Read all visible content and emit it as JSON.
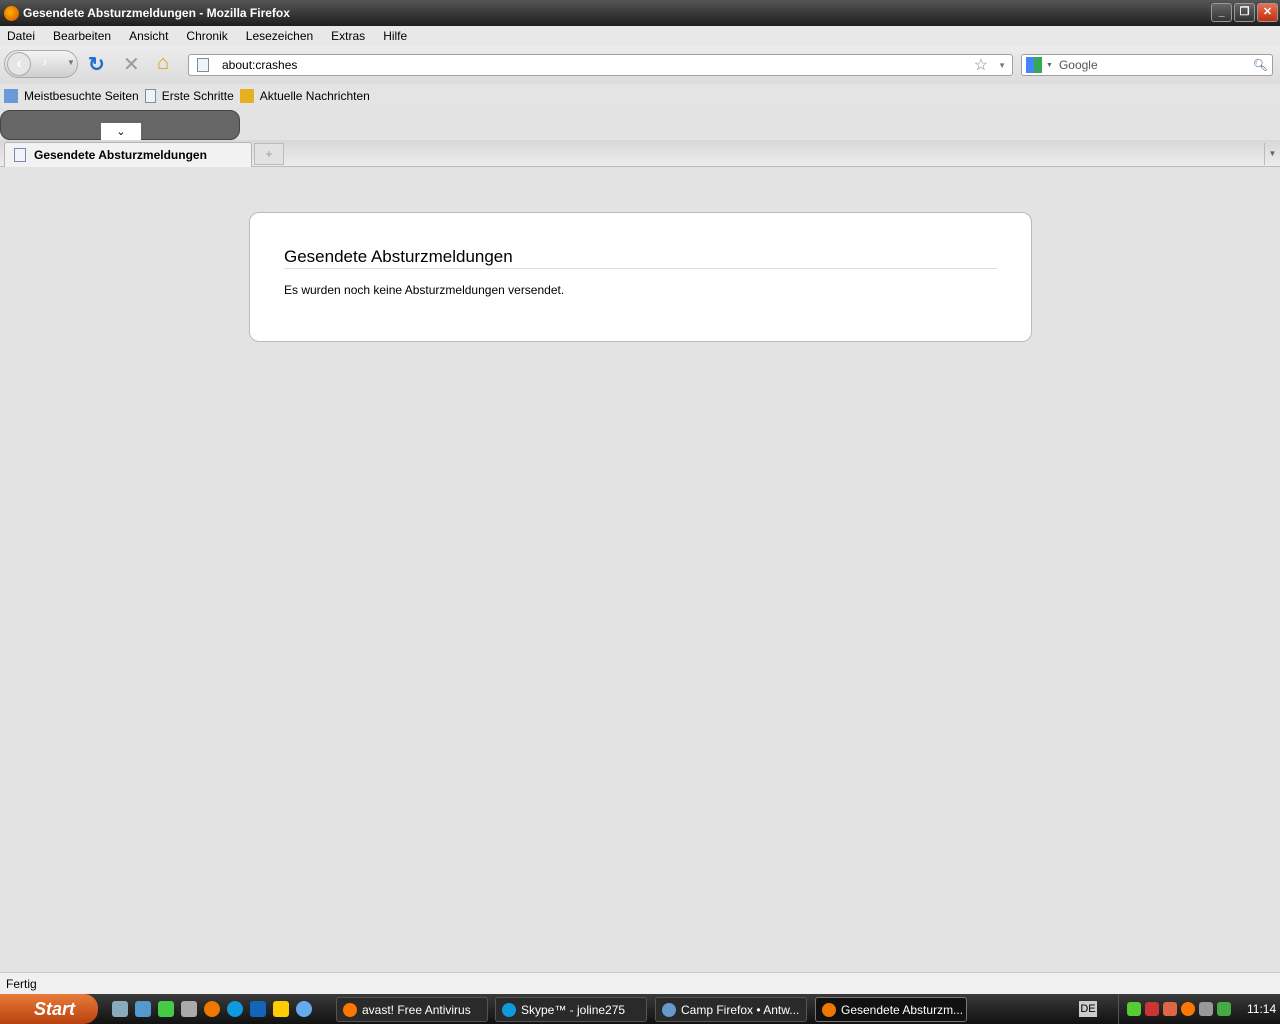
{
  "window": {
    "title": "Gesendete Absturzmeldungen - Mozilla Firefox"
  },
  "menu": [
    "Datei",
    "Bearbeiten",
    "Ansicht",
    "Chronik",
    "Lesezeichen",
    "Extras",
    "Hilfe"
  ],
  "navbar": {
    "url": "about:crashes",
    "search_placeholder": "Google"
  },
  "bookmarks": [
    "Meistbesuchte Seiten",
    "Erste Schritte",
    "Aktuelle Nachrichten"
  ],
  "tabs": [
    {
      "label": "Gesendete Absturzmeldungen"
    }
  ],
  "newtab": "+",
  "page": {
    "heading": "Gesendete Absturzmeldungen",
    "message": "Es wurden noch keine Absturzmeldungen versendet."
  },
  "status": "Fertig",
  "taskbar": {
    "start": "Start",
    "tasks": [
      "avast! Free Antivirus",
      "Skype™ - joline275",
      "Camp Firefox • Antw...",
      "Gesendete Absturzm..."
    ],
    "lang": "DE",
    "clock": "11:14"
  }
}
